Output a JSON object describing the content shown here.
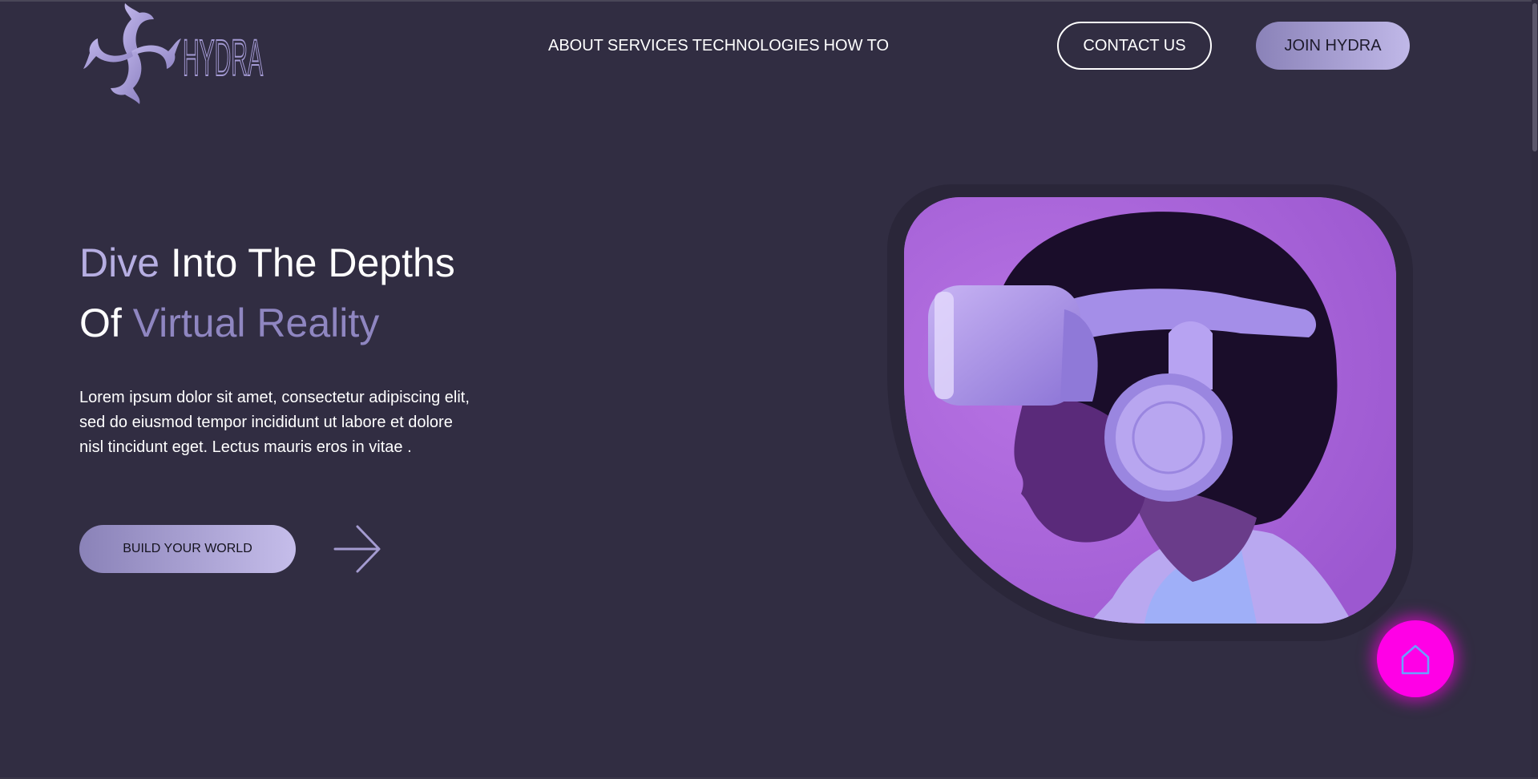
{
  "brand": {
    "name": "HYDRA",
    "logo_icon": "hydra-swirl-logo"
  },
  "nav": {
    "items": [
      {
        "label": "ABOUT"
      },
      {
        "label": "SERVICES"
      },
      {
        "label": "TECHNOLOGIES"
      },
      {
        "label": "HOW TO"
      }
    ],
    "contact_label": "CONTACT US",
    "join_label": "JOIN HYDRA"
  },
  "hero": {
    "title_part1": "Dive",
    "title_part2": " Into The Depths",
    "title_part3": "Of ",
    "title_part4": "Virtual Reality",
    "description": "Lorem ipsum dolor sit amet, consectetur adipiscing elit, sed do eiusmod tempor incididunt ut labore et dolore nisl tincidunt eget. Lectus mauris eros in vitae .",
    "cta_label": "BUILD YOUR WORLD",
    "arrow_icon": "arrow-right-icon",
    "image_subject": "person-wearing-vr-headset"
  },
  "fab": {
    "icon": "home-icon"
  },
  "colors": {
    "background": "#312d42",
    "accent_light": "#b6aee2",
    "accent_dim": "#8f86c1",
    "image_bg": "#aa66d8",
    "fab": "#ff00e6"
  }
}
